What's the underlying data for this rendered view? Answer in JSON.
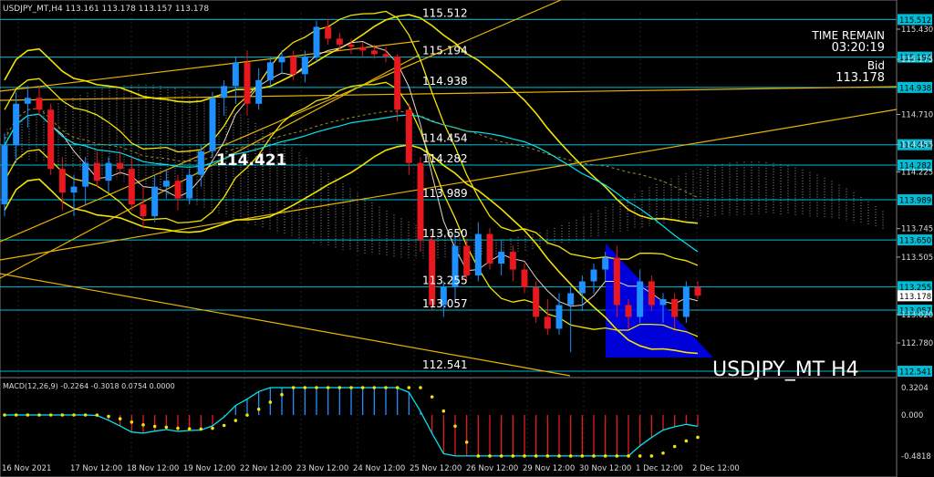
{
  "chart_data": {
    "type": "candlestick",
    "symbol_header": "USDJPY_MT,H4  113.161 113.178 113.157 113.178",
    "watermark": "USDJPY_MT H4",
    "info": {
      "time_remain_label": "TIME REMAIN",
      "time_remain": "03:20:19",
      "bid_label": "Bid",
      "bid": "113.178"
    },
    "big_label": "114.421",
    "price_axis_ticks": [
      "115.430",
      "115.175",
      "114.710",
      "114.455",
      "114.225",
      "113.745",
      "113.505",
      "113.020",
      "112.780"
    ],
    "levels": [
      {
        "value": "115.512",
        "label": "115.512"
      },
      {
        "value": "115.194",
        "label": "115.194"
      },
      {
        "value": "114.938",
        "label": "114.938"
      },
      {
        "value": "114.454",
        "label": "114.454"
      },
      {
        "value": "114.282",
        "label": "114.282"
      },
      {
        "value": "113.989",
        "label": "113.989"
      },
      {
        "value": "113.650",
        "label": "113.650"
      },
      {
        "value": "113.255",
        "label": "113.255"
      },
      {
        "value": "113.057",
        "label": "113.057"
      },
      {
        "value": "112.541",
        "label": "112.541"
      }
    ],
    "current_price": "113.178",
    "x_labels": [
      "16 Nov 2021",
      "17 Nov 12:00",
      "18 Nov 12:00",
      "19 Nov 12:00",
      "22 Nov 12:00",
      "23 Nov 12:00",
      "24 Nov 12:00",
      "25 Nov 12:00",
      "26 Nov 12:00",
      "29 Nov 12:00",
      "30 Nov 12:00",
      "1 Dec 12:00",
      "2 Dec 12:00"
    ],
    "candles": [
      [
        113.95,
        114.55,
        113.85,
        114.45
      ],
      [
        114.45,
        114.9,
        114.3,
        114.8
      ],
      [
        114.8,
        114.95,
        114.6,
        114.85
      ],
      [
        114.85,
        114.95,
        114.7,
        114.75
      ],
      [
        114.75,
        114.8,
        114.2,
        114.25
      ],
      [
        114.25,
        114.35,
        113.9,
        114.05
      ],
      [
        114.05,
        114.2,
        113.85,
        114.1
      ],
      [
        114.1,
        114.35,
        113.95,
        114.3
      ],
      [
        114.3,
        114.4,
        114.1,
        114.15
      ],
      [
        114.15,
        114.35,
        114.05,
        114.3
      ],
      [
        114.3,
        114.4,
        114.2,
        114.25
      ],
      [
        114.25,
        114.35,
        113.9,
        113.95
      ],
      [
        113.95,
        114.1,
        113.75,
        113.85
      ],
      [
        113.85,
        114.2,
        113.8,
        114.1
      ],
      [
        114.1,
        114.25,
        114.0,
        114.15
      ],
      [
        114.15,
        114.2,
        113.9,
        114.0
      ],
      [
        114.0,
        114.25,
        113.95,
        114.2
      ],
      [
        114.2,
        114.45,
        114.1,
        114.4
      ],
      [
        114.4,
        114.9,
        114.35,
        114.85
      ],
      [
        114.85,
        115.0,
        114.7,
        114.95
      ],
      [
        114.95,
        115.2,
        114.8,
        115.15
      ],
      [
        115.15,
        115.25,
        114.7,
        114.8
      ],
      [
        114.8,
        115.1,
        114.75,
        115.0
      ],
      [
        115.0,
        115.2,
        114.95,
        115.15
      ],
      [
        115.15,
        115.25,
        115.05,
        115.2
      ],
      [
        115.2,
        115.25,
        115.0,
        115.05
      ],
      [
        115.05,
        115.25,
        114.98,
        115.2
      ],
      [
        115.2,
        115.5,
        115.15,
        115.45
      ],
      [
        115.45,
        115.52,
        115.3,
        115.35
      ],
      [
        115.35,
        115.4,
        115.25,
        115.3
      ],
      [
        115.3,
        115.35,
        115.22,
        115.28
      ],
      [
        115.28,
        115.32,
        115.2,
        115.25
      ],
      [
        115.25,
        115.3,
        115.18,
        115.22
      ],
      [
        115.22,
        115.28,
        115.15,
        115.2
      ],
      [
        115.2,
        115.22,
        114.65,
        114.75
      ],
      [
        114.75,
        114.8,
        114.2,
        114.3
      ],
      [
        114.3,
        114.35,
        113.55,
        113.65
      ],
      [
        113.65,
        113.7,
        113.05,
        113.1
      ],
      [
        113.1,
        113.3,
        113.0,
        113.25
      ],
      [
        113.25,
        113.7,
        113.15,
        113.6
      ],
      [
        113.6,
        113.65,
        113.3,
        113.35
      ],
      [
        113.35,
        113.8,
        113.3,
        113.7
      ],
      [
        113.7,
        113.75,
        113.4,
        113.45
      ],
      [
        113.45,
        113.65,
        113.35,
        113.55
      ],
      [
        113.55,
        113.6,
        113.3,
        113.4
      ],
      [
        113.4,
        113.45,
        113.2,
        113.25
      ],
      [
        113.25,
        113.3,
        112.95,
        113.0
      ],
      [
        113.0,
        113.15,
        112.85,
        112.9
      ],
      [
        112.9,
        113.2,
        112.85,
        113.1
      ],
      [
        113.1,
        113.25,
        112.7,
        113.2
      ],
      [
        113.2,
        113.35,
        113.05,
        113.3
      ],
      [
        113.3,
        113.45,
        113.2,
        113.4
      ],
      [
        113.4,
        113.55,
        113.3,
        113.5
      ],
      [
        113.5,
        113.6,
        113.0,
        113.1
      ],
      [
        113.1,
        113.15,
        112.9,
        113.0
      ],
      [
        113.0,
        113.4,
        112.95,
        113.3
      ],
      [
        113.3,
        113.35,
        113.05,
        113.1
      ],
      [
        113.1,
        113.2,
        112.95,
        113.15
      ],
      [
        113.15,
        113.2,
        112.9,
        113.0
      ],
      [
        113.0,
        113.3,
        112.95,
        113.25
      ],
      [
        113.25,
        113.3,
        113.15,
        113.18
      ]
    ],
    "macd": {
      "label": "MACD(12,26,9) -0.2264 -0.3018 0.0754 0.0000",
      "axis_ticks": [
        "0.3204",
        "0.000",
        "-0.4818"
      ]
    },
    "colors": {
      "bull": "#1e90ff",
      "bear": "#e8191e",
      "level": "#00bcd4",
      "yellow": "#f2e300",
      "cyan": "#00e5ee",
      "ichimoku": "#bbbbbb"
    }
  }
}
